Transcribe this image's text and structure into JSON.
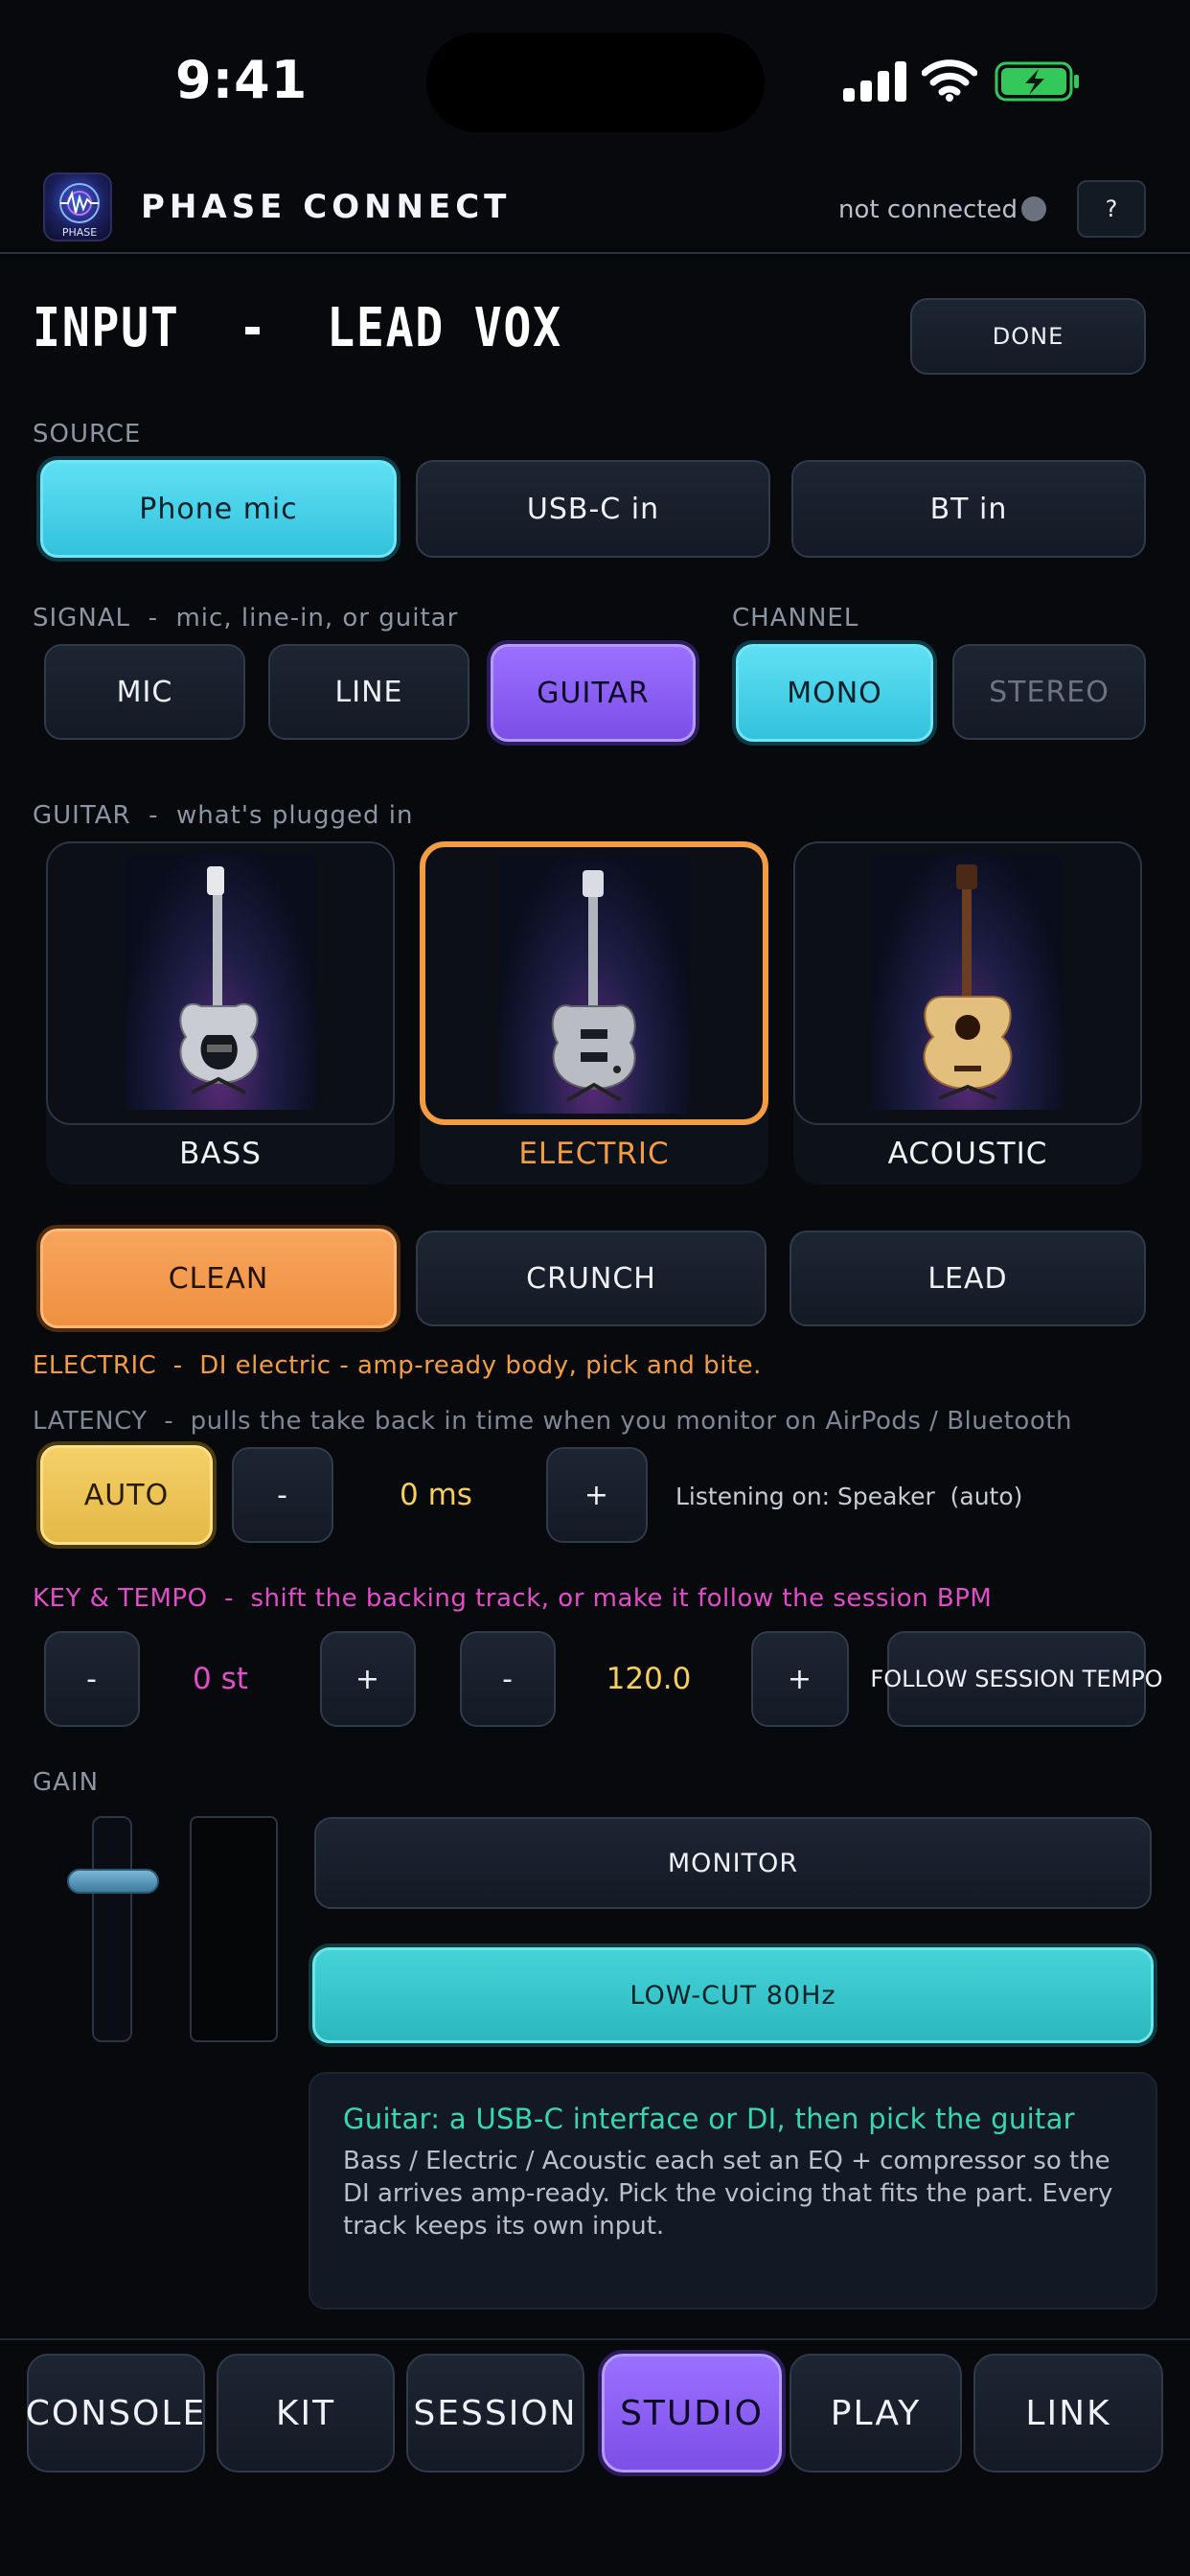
{
  "status_bar": {
    "time": "9:41"
  },
  "header": {
    "logo_text": "PHASE",
    "app_title": "PHASE CONNECT",
    "connection_status": "not connected",
    "help_label": "?"
  },
  "page": {
    "title": "INPUT  -  LEAD VOX",
    "done_label": "DONE"
  },
  "source": {
    "label": "SOURCE",
    "options": [
      "Phone mic",
      "USB-C in",
      "BT in"
    ],
    "selected": "Phone mic"
  },
  "signal": {
    "label": "SIGNAL  -  mic, line-in, or guitar",
    "options": [
      "MIC",
      "LINE",
      "GUITAR"
    ],
    "selected": "GUITAR"
  },
  "channel": {
    "label": "CHANNEL",
    "options": [
      "MONO",
      "STEREO"
    ],
    "selected": "MONO"
  },
  "guitar": {
    "label": "GUITAR  -  what's plugged in",
    "types": [
      {
        "label": "BASS",
        "image": "bass-guitar-photo"
      },
      {
        "label": "ELECTRIC",
        "image": "electric-guitar-photo"
      },
      {
        "label": "ACOUSTIC",
        "image": "acoustic-guitar-photo"
      }
    ],
    "selected": "ELECTRIC",
    "voicings": [
      "CLEAN",
      "CRUNCH",
      "LEAD"
    ],
    "selected_voicing": "CLEAN",
    "description": "ELECTRIC  -  DI electric - amp-ready body, pick and bite."
  },
  "latency": {
    "label": "LATENCY  -  pulls the take back in time when you monitor on AirPods / Bluetooth",
    "auto_label": "AUTO",
    "decrement_label": "-",
    "value": "0 ms",
    "increment_label": "+",
    "listening": "Listening on: Speaker  (auto)"
  },
  "key_tempo": {
    "label": "KEY & TEMPO  -  shift the backing track, or make it follow the session BPM",
    "key_decrement": "-",
    "key_value": "0 st",
    "key_increment": "+",
    "tempo_decrement": "-",
    "tempo_value": "120.0",
    "tempo_increment": "+",
    "follow_label": "FOLLOW SESSION TEMPO"
  },
  "gain": {
    "label": "GAIN",
    "monitor_label": "MONITOR",
    "lowcut_label": "LOW-CUT 80Hz"
  },
  "info": {
    "title": "Guitar: a USB-C interface or DI, then pick the guitar",
    "body": "Bass / Electric / Acoustic each set an EQ + compressor so the DI arrives amp-ready. Pick the voicing that fits the part. Every track keeps its own input."
  },
  "nav": {
    "tabs": [
      "CONSOLE",
      "KIT",
      "SESSION",
      "STUDIO",
      "PLAY",
      "LINK"
    ],
    "selected": "STUDIO"
  },
  "colors": {
    "cyan": "#4fd6ec",
    "purple": "#8c5ff5",
    "orange": "#f49c42",
    "gold": "#f0c856",
    "teal": "#3bc7cd",
    "pink": "#e24ec8",
    "yellow_value": "#f6cf5a",
    "green_info": "#36d8b0"
  }
}
